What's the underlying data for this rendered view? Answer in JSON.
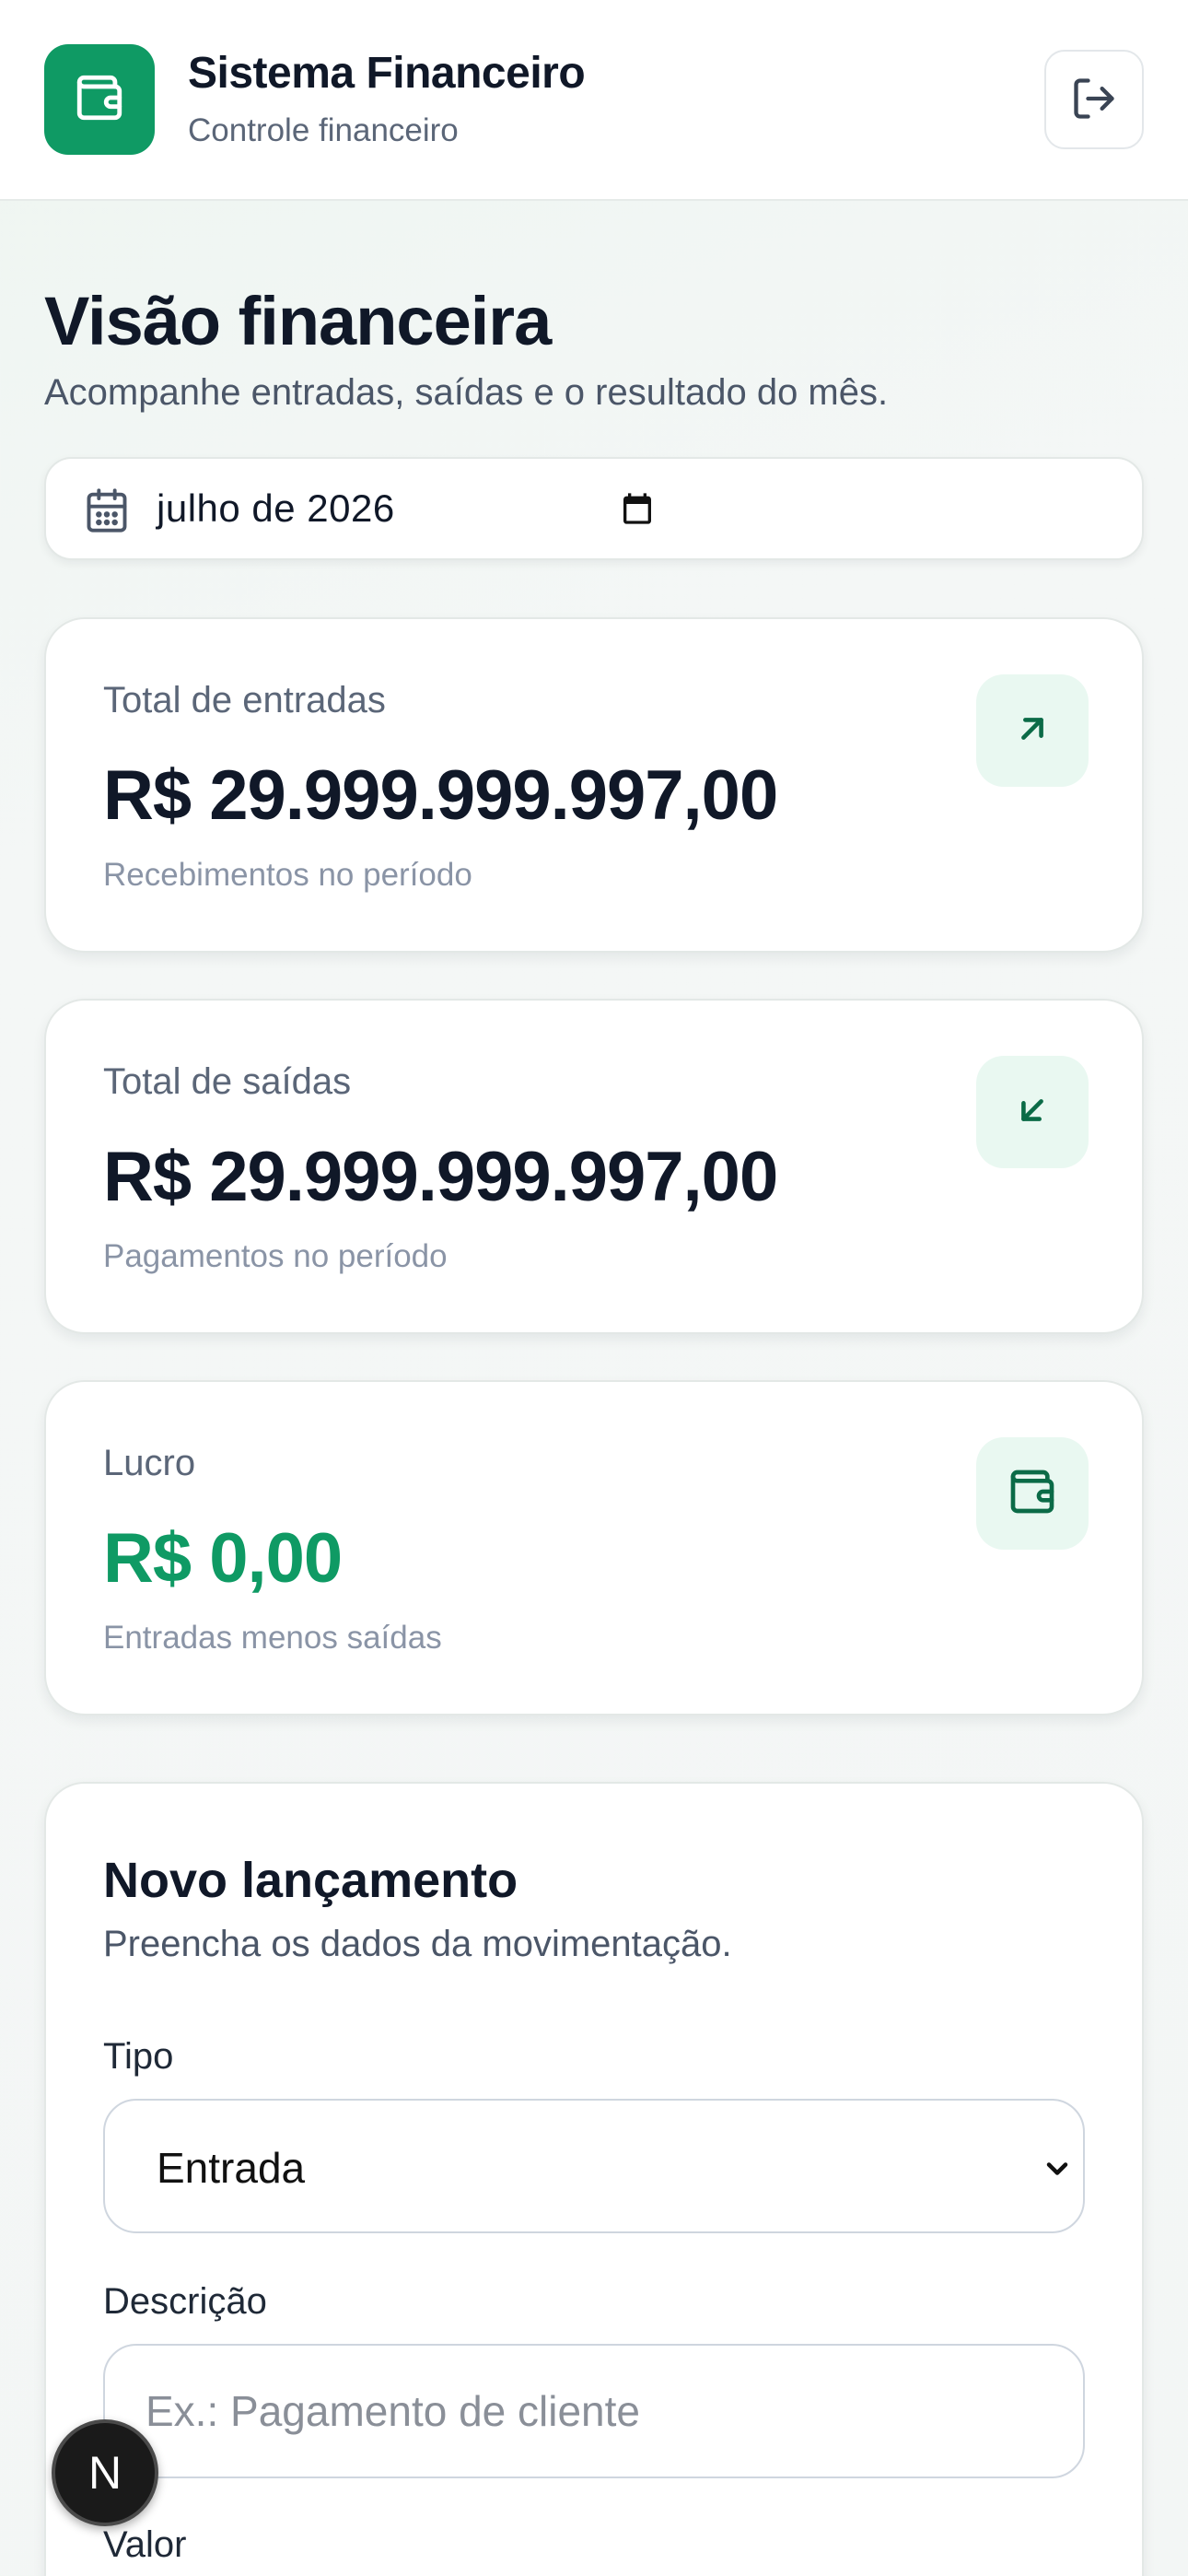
{
  "header": {
    "app_title": "Sistema Financeiro",
    "app_subtitle": "Controle financeiro",
    "logo_icon": "wallet-icon",
    "logout_icon": "logout-icon"
  },
  "overview": {
    "title": "Visão financeira",
    "subtitle": "Acompanhe entradas, saídas e o resultado do mês.",
    "month_picker": {
      "value": "julho de 2026",
      "icon": "calendar-icon"
    }
  },
  "stats": [
    {
      "label": "Total de entradas",
      "value": "R$ 29.999.999.997,00",
      "hint": "Recebimentos no período",
      "icon": "arrow-up-right-icon"
    },
    {
      "label": "Total de saídas",
      "value": "R$ 29.999.999.997,00",
      "hint": "Pagamentos no período",
      "icon": "arrow-down-left-icon"
    },
    {
      "label": "Lucro",
      "value": "R$ 0,00",
      "hint": "Entradas menos saídas",
      "icon": "wallet-icon"
    }
  ],
  "form": {
    "title": "Novo lançamento",
    "subtitle": "Preencha os dados da movimentação.",
    "type_label": "Tipo",
    "type_value": "Entrada",
    "description_label": "Descrição",
    "description_placeholder": "Ex.: Pagamento de cliente",
    "description_value": "",
    "value_label": "Valor"
  },
  "dev_badge": {
    "label": "N"
  },
  "colors": {
    "brand": "#0f9a64",
    "icon_bg": "#e9f8f1",
    "text_primary": "#101828",
    "text_muted": "#5b6678"
  }
}
